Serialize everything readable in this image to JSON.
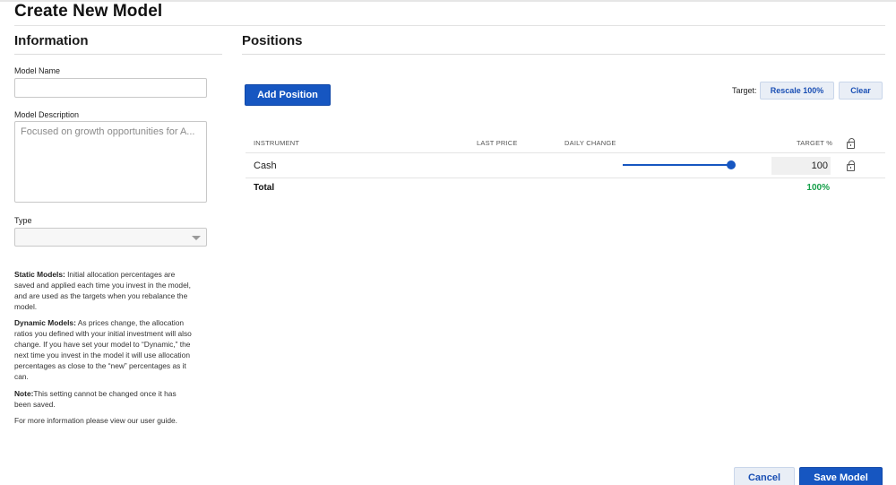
{
  "page": {
    "title": "Create New Model"
  },
  "information": {
    "heading": "Information",
    "model_name": {
      "label": "Model Name",
      "value": "",
      "placeholder": ""
    },
    "model_description": {
      "label": "Model Description",
      "value": "",
      "placeholder": "Focused on growth opportunities for A..."
    },
    "type": {
      "label": "Type",
      "selected": ""
    },
    "help": {
      "static_title": "Static Models:",
      "static_text": " Initial allocation percentages are saved and applied each time you invest in the model, and are used as the targets when you rebalance the model.",
      "dynamic_title": "Dynamic Models:",
      "dynamic_text": " As prices change, the allocation ratios you defined with your initial investment will also change. If you have set your model to “Dynamic,” the next time you invest in the model it will use allocation percentages as close to the “new” percentages as it can.",
      "note_title": "Note:",
      "note_text": "This setting cannot be changed once it has been saved.",
      "more": "For more information please view our user guide."
    }
  },
  "positions": {
    "heading": "Positions",
    "add_button": "Add Position",
    "target_label": "Target:",
    "rescale_button": "Rescale 100%",
    "clear_button": "Clear",
    "columns": {
      "instrument": "INSTRUMENT",
      "last_price": "LAST PRICE",
      "daily_change": "DAILY CHANGE",
      "target": "TARGET %"
    },
    "rows": [
      {
        "instrument": "Cash",
        "last_price": "",
        "daily_change": "",
        "target": "100",
        "slider_fraction": 1.0
      }
    ],
    "total": {
      "label": "Total",
      "value": "100%"
    }
  },
  "footer": {
    "cancel_button": "Cancel",
    "save_button": "Save Model"
  },
  "colors": {
    "primary": "#1656c1",
    "total_green": "#16a04a",
    "light_button": "#e9eef6"
  },
  "icons": {
    "lock": "lock-icon",
    "dropdown": "chevron-down-icon"
  }
}
